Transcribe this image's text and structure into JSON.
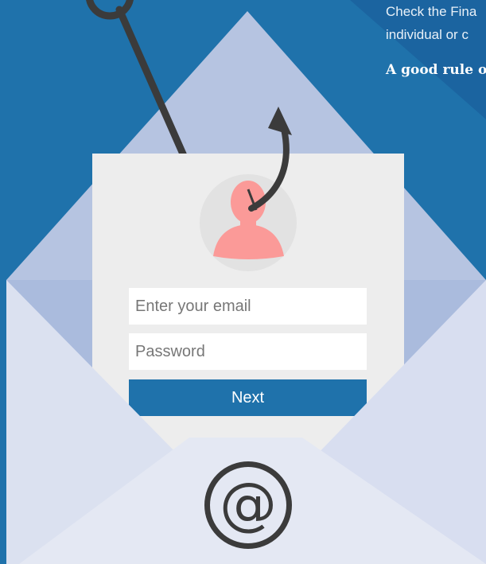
{
  "side_panel": {
    "line1": "Check the Fina",
    "line2": "individual or c",
    "rule": "A good rule of"
  },
  "login_form": {
    "email_placeholder": "Enter your email",
    "password_placeholder": "Password",
    "next_label": "Next"
  },
  "envelope": {
    "symbol": "@"
  },
  "icons": {
    "hook": "fishing-hook-icon",
    "avatar": "user-avatar-icon",
    "at": "at-sign-icon"
  },
  "colors": {
    "background_blue": "#1f72ab",
    "envelope_light": "#dde3f0",
    "envelope_mid": "#b6c4e1",
    "card": "#ededed",
    "avatar_pink": "#fb9a98",
    "hook_dark": "#3b3b3b"
  }
}
